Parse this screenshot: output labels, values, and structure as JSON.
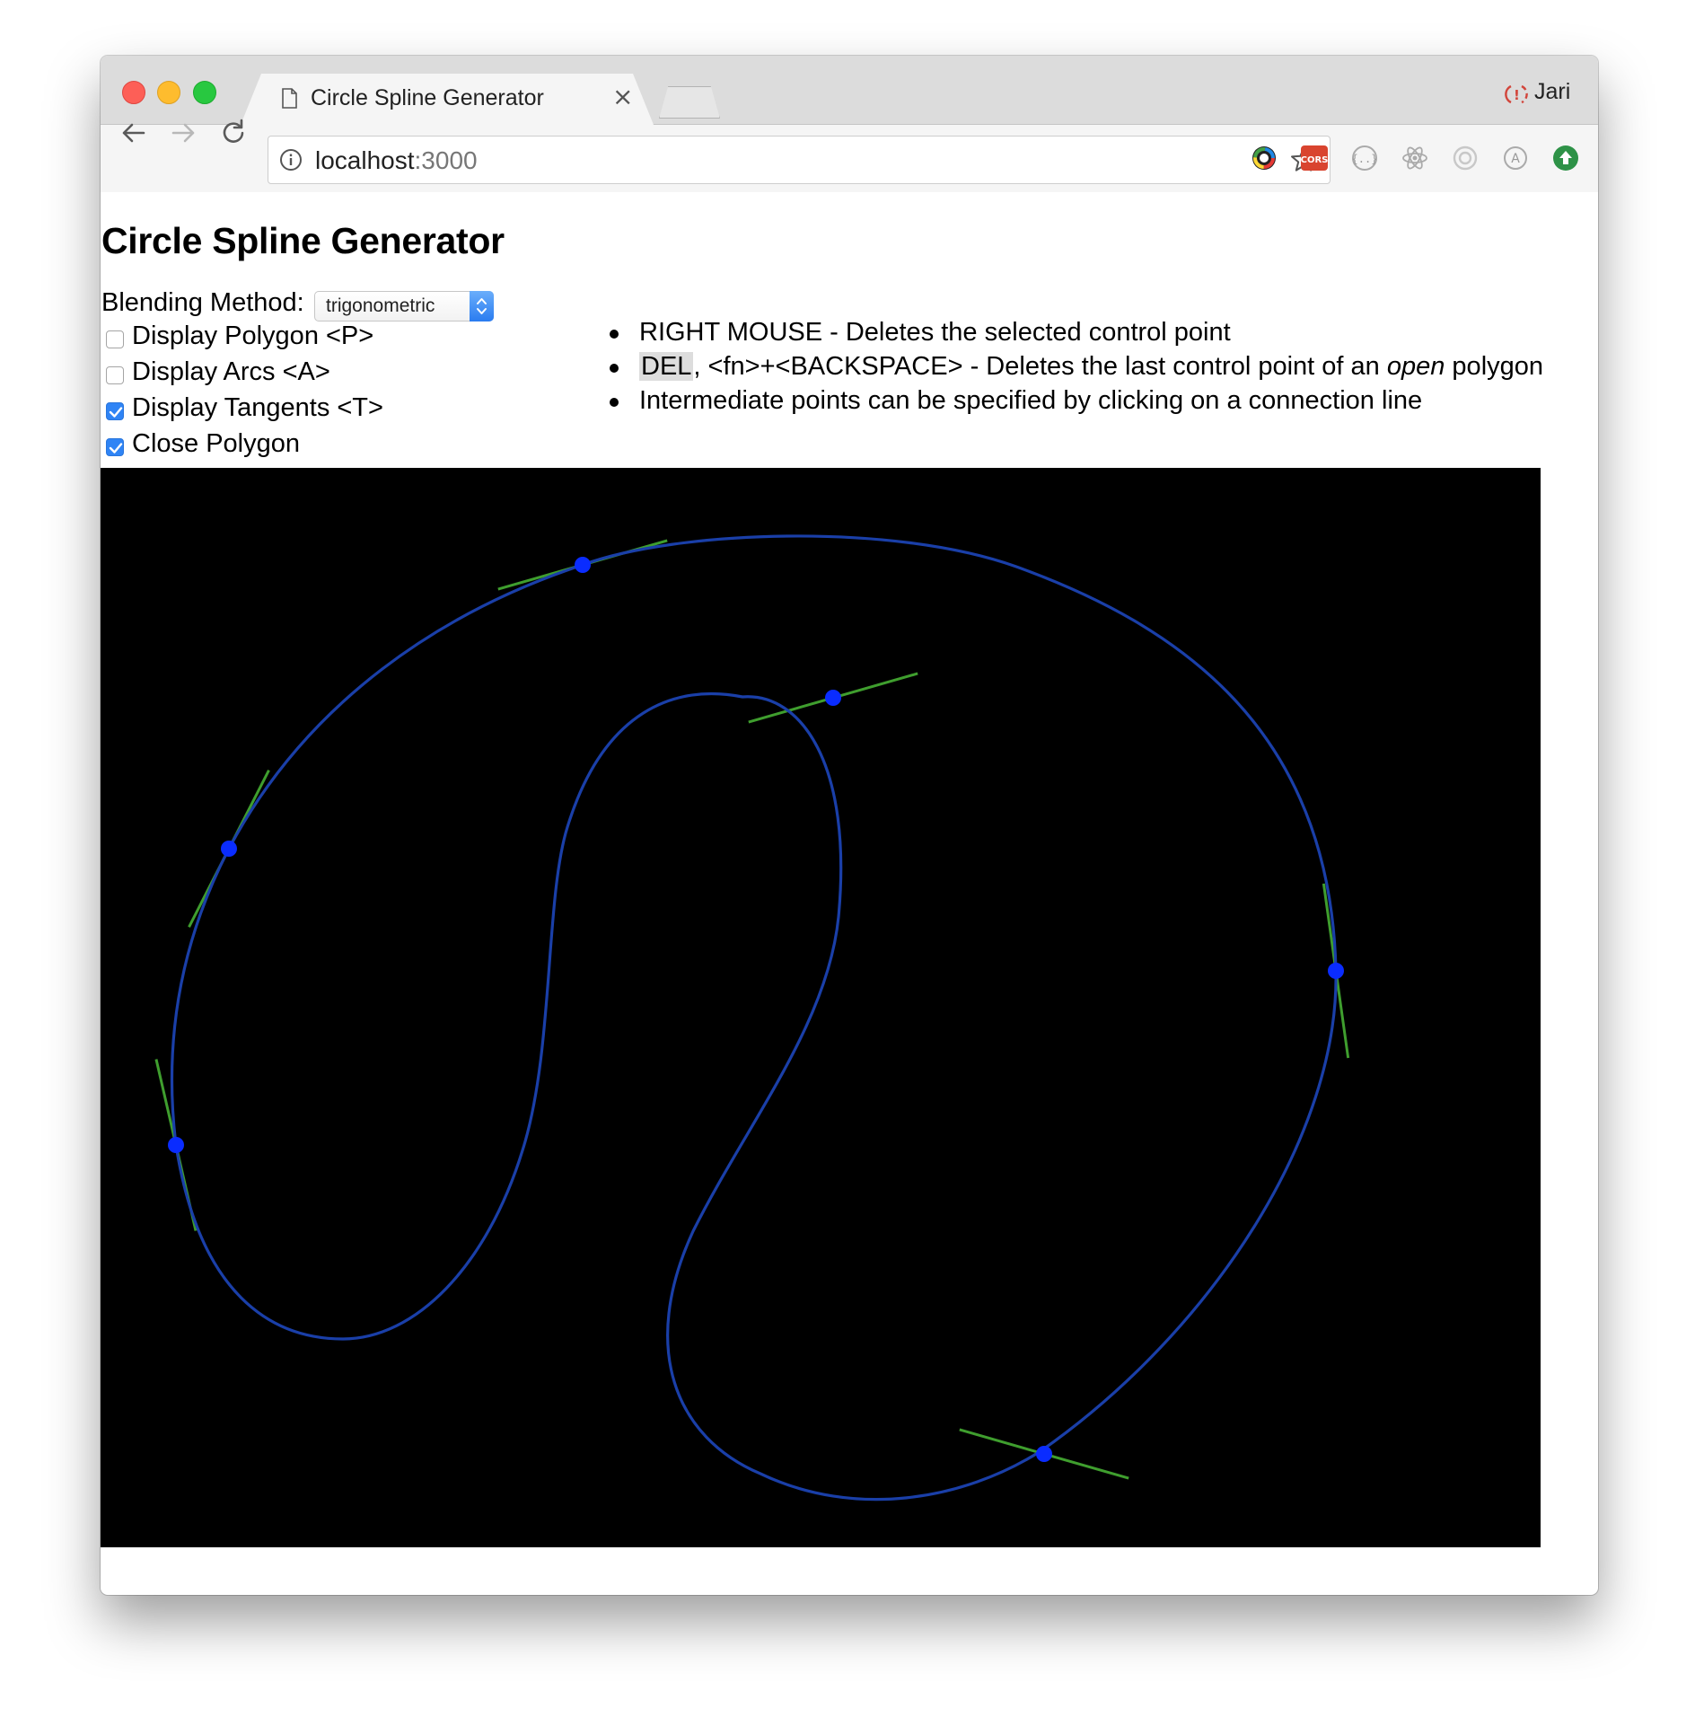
{
  "browser": {
    "tab_title": "Circle Spline Generator",
    "tab_close": "×",
    "profile_name": "Jari",
    "url_host": "localhost",
    "url_port": ":3000",
    "extensions": [
      "color-picker-icon",
      "cors-icon",
      "json-viewer-icon",
      "react-devtools-icon",
      "redux-devtools-icon",
      "adblock-icon",
      "upload-icon"
    ]
  },
  "page": {
    "title": "Circle Spline Generator",
    "blending_label": "Blending Method:",
    "blending_value": "trigonometric",
    "options": [
      {
        "label": "Display Polygon <P>",
        "checked": false
      },
      {
        "label": "Display Arcs <A>",
        "checked": false
      },
      {
        "label": "Display Tangents <T>",
        "checked": true
      },
      {
        "label": "Close Polygon",
        "checked": true
      }
    ],
    "help": {
      "item1": "RIGHT MOUSE - Deletes the selected control point",
      "item2_key": "DEL",
      "item2_mid": ", <fn>+<BACKSPACE> - Deletes the last control point of an ",
      "item2_em": "open",
      "item2_end": " polygon",
      "item3": "Intermediate points can be specified by clicking on a connection line"
    }
  },
  "colors": {
    "canvas_bg": "#000000",
    "curve": "#1a3fa8",
    "tangent": "#3f9e2e",
    "control_point": "#0a2cff"
  }
}
